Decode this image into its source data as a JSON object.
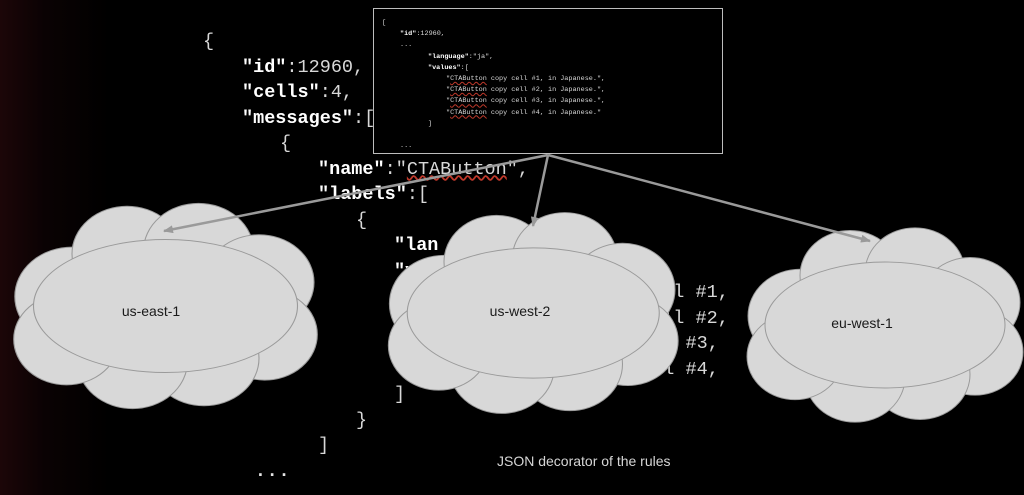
{
  "main_code": {
    "open_brace": "{",
    "id_key": "\"id\"",
    "id_val": ":12960,",
    "cells_key": "\"cells\"",
    "cells_val": ":4,",
    "messages_key": "\"messages\"",
    "messages_val": ":[",
    "msg_open": "{",
    "name_key": "\"name\"",
    "name_val_pre": ":\"",
    "name_val_word": "CTAButton",
    "name_val_post": "\",",
    "labels_key": "\"labels\"",
    "labels_val": ":[",
    "label_open": "{",
    "lang_partial": "\"lan",
    "values_partial": "\"v",
    "value_line_1": "cell #1,",
    "value_line_2": "cell #2,",
    "value_line_3": "cell #3,",
    "value_line_4": "cell #4,",
    "values_close": "]",
    "label_close": "}",
    "labels_close": "]",
    "ellipsis": "..."
  },
  "popup_code": {
    "open_bracket": "[",
    "id_key": "\"id\"",
    "id_val": ":12960,",
    "dots_1": "...",
    "language_key": "\"language\"",
    "language_val": ":\"ja\",",
    "values_key": "\"values\"",
    "values_val": ":[",
    "values": [
      {
        "pre": "\"",
        "word": "CTAButton",
        "post": " copy cell #1, in Japanese.\","
      },
      {
        "pre": "\"",
        "word": "CTAButton",
        "post": " copy cell #2, in Japanese.\","
      },
      {
        "pre": "\"",
        "word": "CTAButton",
        "post": " copy cell #3, in Japanese.\","
      },
      {
        "pre": "\"",
        "word": "CTAButton",
        "post": " copy cell #4, in Japanese.\""
      }
    ],
    "values_close": "]",
    "dots_2": "..."
  },
  "regions": [
    {
      "label": "us-east-1"
    },
    {
      "label": "us-west-2"
    },
    {
      "label": "eu-west-1"
    }
  ],
  "caption": "JSON decorator of the rules",
  "colors": {
    "background": "#000000",
    "cloud_fill": "#d8d8d8",
    "cloud_stroke": "#9a9a9a",
    "arrow": "#9a9a9a",
    "code_text": "#d8d8d8",
    "popup_border": "#bdbdbd",
    "spellcheck_squiggle": "#c0392b"
  }
}
